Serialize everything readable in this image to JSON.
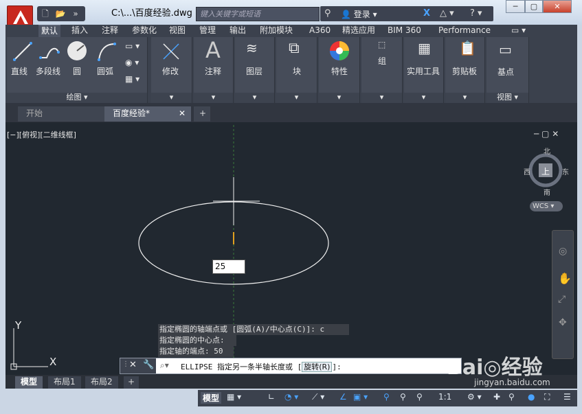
{
  "window": {
    "doc_title": "C:\\...\\百度经验.dwg",
    "search_placeholder": "键入关键字或短语",
    "login_label": "登录",
    "minimize": "─",
    "restore": "▢",
    "close": "✕"
  },
  "ribbon": {
    "tabs": [
      "默认",
      "插入",
      "注释",
      "参数化",
      "视图",
      "管理",
      "输出",
      "附加模块",
      "A360",
      "精选应用",
      "BIM 360",
      "Performance"
    ],
    "active_tab": "默认",
    "draw_tools": {
      "line": "直线",
      "polyline": "多段线",
      "circle": "圆",
      "arc": "圆弧"
    },
    "draw_footer": "绘图 ▾",
    "panels": [
      "修改",
      "注释",
      "图层",
      "块",
      "特性",
      "组",
      "实用工具",
      "剪贴板",
      "基点"
    ],
    "view_footer": "视图 ▾"
  },
  "file_tabs": {
    "start": "开始",
    "current": "百度经验*",
    "add": "+"
  },
  "viewport": {
    "label": "[−][俯视][二维线框]",
    "compass": {
      "north": "北",
      "south": "南",
      "east": "东",
      "west": "西",
      "top": "上"
    },
    "wcs": "WCS",
    "axis_x": "X",
    "axis_y": "Y"
  },
  "command": {
    "history": [
      "指定椭圆的轴端点或 [圆弧(A)/中心点(C)]: c",
      "指定椭圆的中心点:",
      "指定轴的端点: 50"
    ],
    "prompt_prefix": "ELLIPSE 指定另一条半轴长度或 [",
    "option": "旋转(R)",
    "prompt_suffix": "]:",
    "dynamic_input": "25"
  },
  "layout_tabs": [
    "模型",
    "布局1",
    "布局2"
  ],
  "status": {
    "model": "模型",
    "scale": "1:1"
  },
  "watermark": {
    "brand": "Bai◎经验",
    "url": "jingyan.baidu.com"
  }
}
